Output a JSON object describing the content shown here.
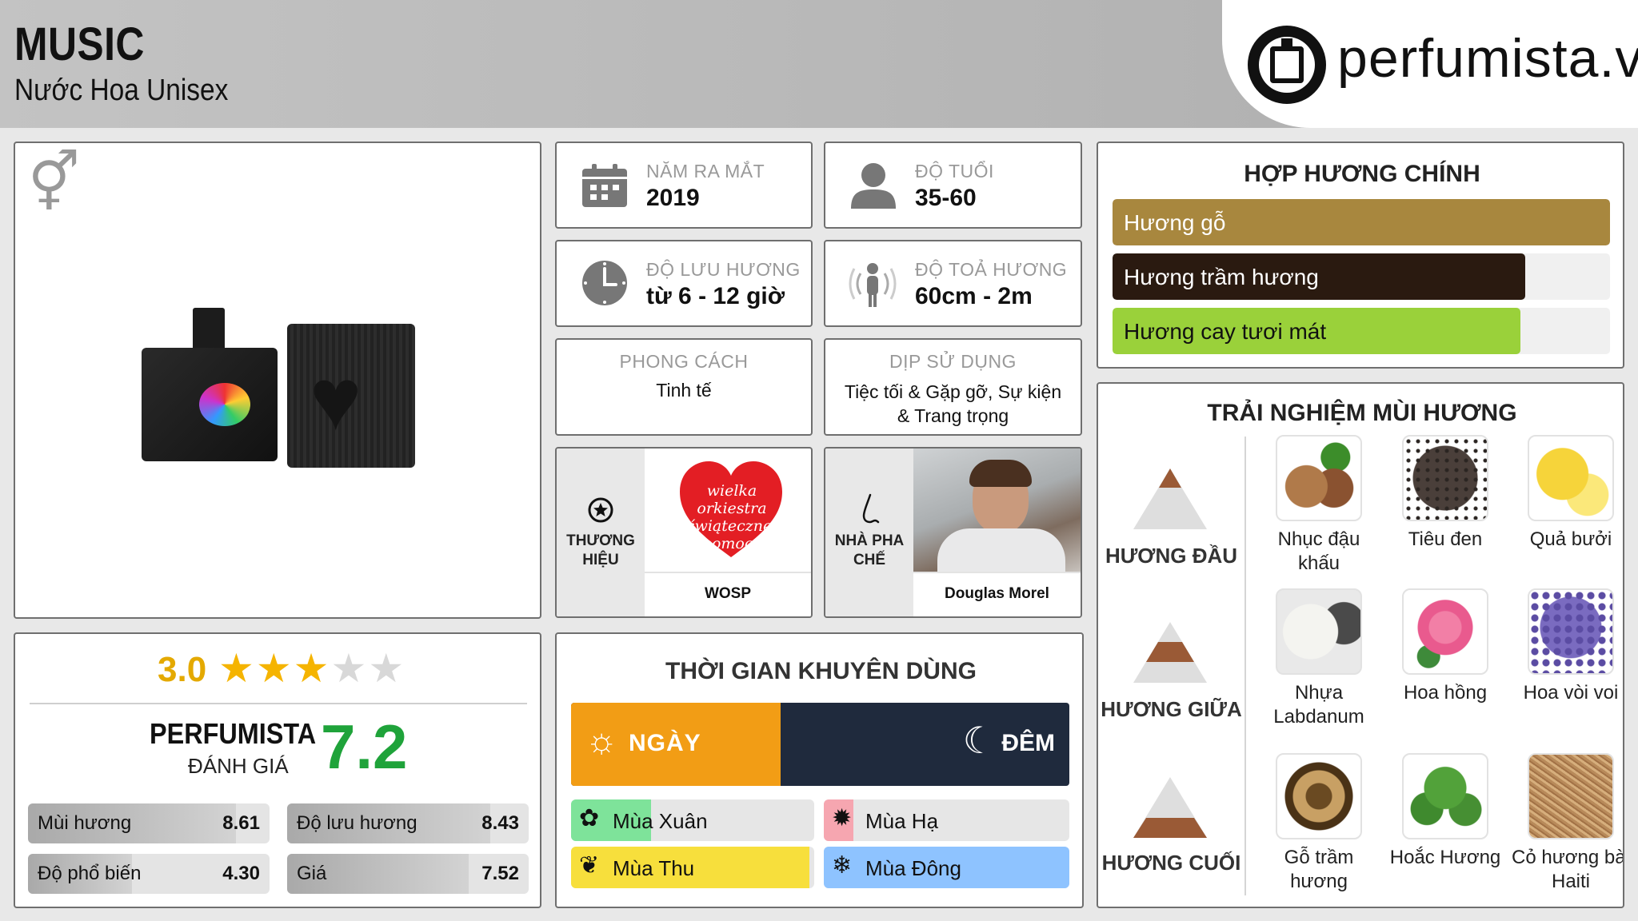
{
  "header": {
    "title": "MUSIC",
    "subtitle": "Nước Hoa Unisex",
    "logo_text": "perfumista.vn"
  },
  "rating": {
    "score": "3.0",
    "stars_filled": 3,
    "stars_total": 5,
    "perfumista_label": "PERFUMISTA",
    "perfumista_sublabel": "ĐÁNH GIÁ",
    "perfumista_score": "7.2",
    "metrics": [
      {
        "label": "Mùi hương",
        "value": "8.61"
      },
      {
        "label": "Độ lưu hương",
        "value": "8.43"
      },
      {
        "label": "Độ phổ biến",
        "value": "4.30"
      },
      {
        "label": "Giá",
        "value": "7.52"
      }
    ]
  },
  "info": {
    "release": {
      "label": "NĂM RA MẮT",
      "value": "2019"
    },
    "age": {
      "label": "ĐỘ TUỔI",
      "value": "35-60"
    },
    "longevity": {
      "label": "ĐỘ LƯU HƯƠNG",
      "value": "từ 6 - 12 giờ"
    },
    "sillage": {
      "label": "ĐỘ TOẢ HƯƠNG",
      "value": "60cm - 2m"
    },
    "style": {
      "label": "PHONG CÁCH",
      "value": "Tinh tế"
    },
    "occasion": {
      "label": "DỊP SỬ DỤNG",
      "value": "Tiệc tối & Gặp gỡ, Sự kiện & Trang trọng"
    }
  },
  "brand": {
    "label": "THƯƠNG HIỆU",
    "name": "WOSP",
    "logo_text": "wielka orkiestra świątecznej pomocy"
  },
  "perfumer": {
    "label": "NHÀ PHA CHẾ",
    "name": "Douglas Morel"
  },
  "season": {
    "title": "THỜI GIAN KHUYÊN DÙNG",
    "day_label": "NGÀY",
    "night_label": "ĐÊM",
    "day_fraction": 0.42,
    "items": [
      {
        "label": "Mùa Xuân",
        "color": "#7ee39a",
        "level": 0.33
      },
      {
        "label": "Mùa Hạ",
        "color": "#f6a6b0",
        "level": 0.12
      },
      {
        "label": "Mùa Thu",
        "color": "#f7df3c",
        "level": 0.98
      },
      {
        "label": "Mùa Đông",
        "color": "#8ec3ff",
        "level": 1.0
      }
    ]
  },
  "accords": {
    "title": "HỢP HƯƠNG CHÍNH",
    "items": [
      {
        "label": "Hương gỗ",
        "color": "#a8873e",
        "level": 1.0
      },
      {
        "label": "Hương trầm hương",
        "color": "#2a1a10",
        "level": 0.83
      },
      {
        "label": "Hương cay tươi mát",
        "color": "#9ad13a",
        "level": 0.82
      }
    ]
  },
  "notes": {
    "title": "TRẢI NGHIỆM MÙI HƯƠNG",
    "top_label": "HƯƠNG ĐẦU",
    "middle_label": "HƯƠNG GIỮA",
    "base_label": "HƯƠNG CUỐI",
    "top": [
      "Nhục đậu khấu Indonesia",
      "Tiêu đen",
      "Quả bưởi"
    ],
    "middle": [
      "Nhựa Labdanum Pháp",
      "Hoa hồng",
      "Hoa vòi voi"
    ],
    "base": [
      "Gỗ trầm hương",
      "Hoắc Hương",
      "Cỏ hương bài Haiti"
    ]
  }
}
